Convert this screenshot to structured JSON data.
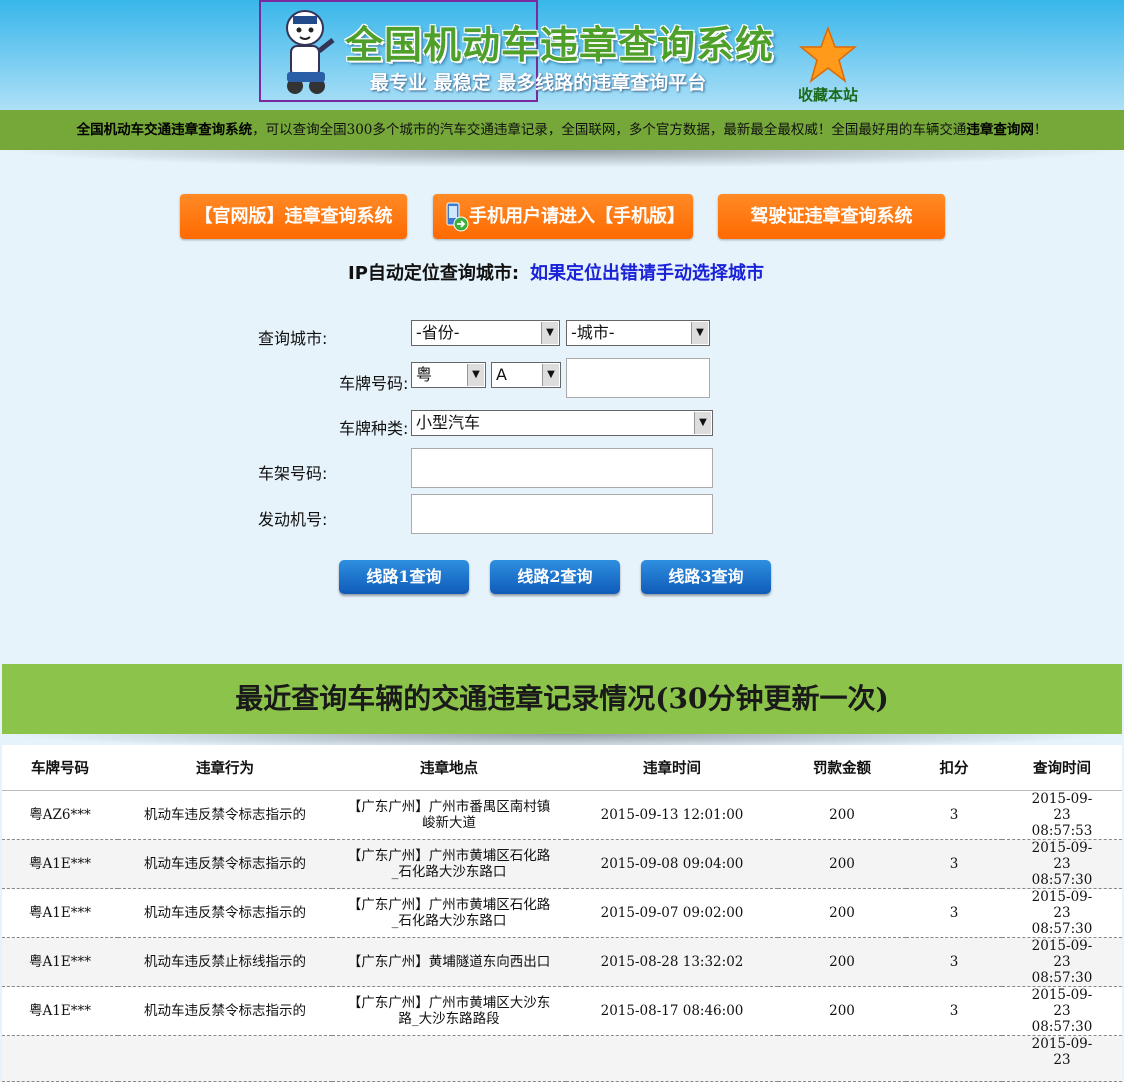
{
  "header": {
    "title": "全国机动车违章查询系统",
    "subtitle": "最专业 最稳定 最多线路的违章查询平台",
    "favorite_label": "收藏本站"
  },
  "banner": {
    "bold1": "全国机动车交通违章查询系统",
    "text1": "，可以查询全国300多个城市的汽车交通违章记录，全国联网，多个官方数据，最新最全最权威！全国最好用的车辆交通",
    "bold2": "违章查询网",
    "text2": "！"
  },
  "nav_buttons": {
    "official": "【官网版】违章查询系统",
    "mobile": "手机用户请进入【手机版】",
    "license": "驾驶证违章查询系统"
  },
  "ip_location": {
    "label": "IP自动定位查询城市:",
    "link": "如果定位出错请手动选择城市"
  },
  "form": {
    "city_label": "查询城市:",
    "province_value": "-省份-",
    "city_value": "-城市-",
    "plate_label": "车牌号码:",
    "plate_prefix": "粤",
    "plate_letter": "A",
    "plate_type_label": "车牌种类:",
    "plate_type_value": "小型汽车",
    "vin_label": "车架号码:",
    "engine_label": "发动机号:"
  },
  "query_buttons": [
    "线路1查询",
    "线路2查询",
    "线路3查询"
  ],
  "records": {
    "title": "最近查询车辆的交通违章记录情况(30分钟更新一次)",
    "columns": [
      "车牌号码",
      "违章行为",
      "违章地点",
      "违章时间",
      "罚款金额",
      "扣分",
      "查询时间"
    ],
    "rows": [
      [
        "粤AZ6***",
        "机动车违反禁令标志指示的",
        "【广东广州】广州市番禺区南村镇峻新大道",
        "2015-09-13 12:01:00",
        "200",
        "3",
        "2015-09-23 08:57:53"
      ],
      [
        "粤A1E***",
        "机动车违反禁令标志指示的",
        "【广东广州】广州市黄埔区石化路_石化路大沙东路口",
        "2015-09-08 09:04:00",
        "200",
        "3",
        "2015-09-23 08:57:30"
      ],
      [
        "粤A1E***",
        "机动车违反禁令标志指示的",
        "【广东广州】广州市黄埔区石化路_石化路大沙东路口",
        "2015-09-07 09:02:00",
        "200",
        "3",
        "2015-09-23 08:57:30"
      ],
      [
        "粤A1E***",
        "机动车违反禁止标线指示的",
        "【广东广州】黄埔隧道东向西出口",
        "2015-08-28 13:32:02",
        "200",
        "3",
        "2015-09-23 08:57:30"
      ],
      [
        "粤A1E***",
        "机动车违反禁令标志指示的",
        "【广东广州】广州市黄埔区大沙东路_大沙东路路段",
        "2015-08-17 08:46:00",
        "200",
        "3",
        "2015-09-23 08:57:30"
      ],
      [
        "",
        "",
        "",
        "",
        "",
        "",
        "2015-09-23"
      ]
    ]
  },
  "colors": {
    "header_top": "#38b6ea",
    "banner_green": "#75a739",
    "records_green": "#8cc34a",
    "orange": "#ff7a10",
    "link_blue": "#1a22d8"
  }
}
